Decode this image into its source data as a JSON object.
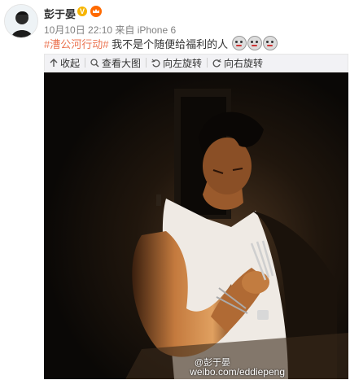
{
  "post": {
    "username": "彭于晏",
    "date": "10月10日 22:10",
    "source_prefix": "来自",
    "device": "iPhone 6",
    "topic": "#漕公河行动#",
    "text": " 我不是个随便给福利的人",
    "emoji_count": 3
  },
  "toolbar": {
    "collapse": "收起",
    "view_large": "查看大图",
    "rotate_left": "向左旋转",
    "rotate_right": "向右旋转"
  },
  "image": {
    "watermark_user": "@彭于晏",
    "watermark_url": "weibo.com/eddiepeng"
  },
  "colors": {
    "topic": "#eb7350",
    "meta": "#808080",
    "toolbar_bg": "#f2f2f5"
  }
}
